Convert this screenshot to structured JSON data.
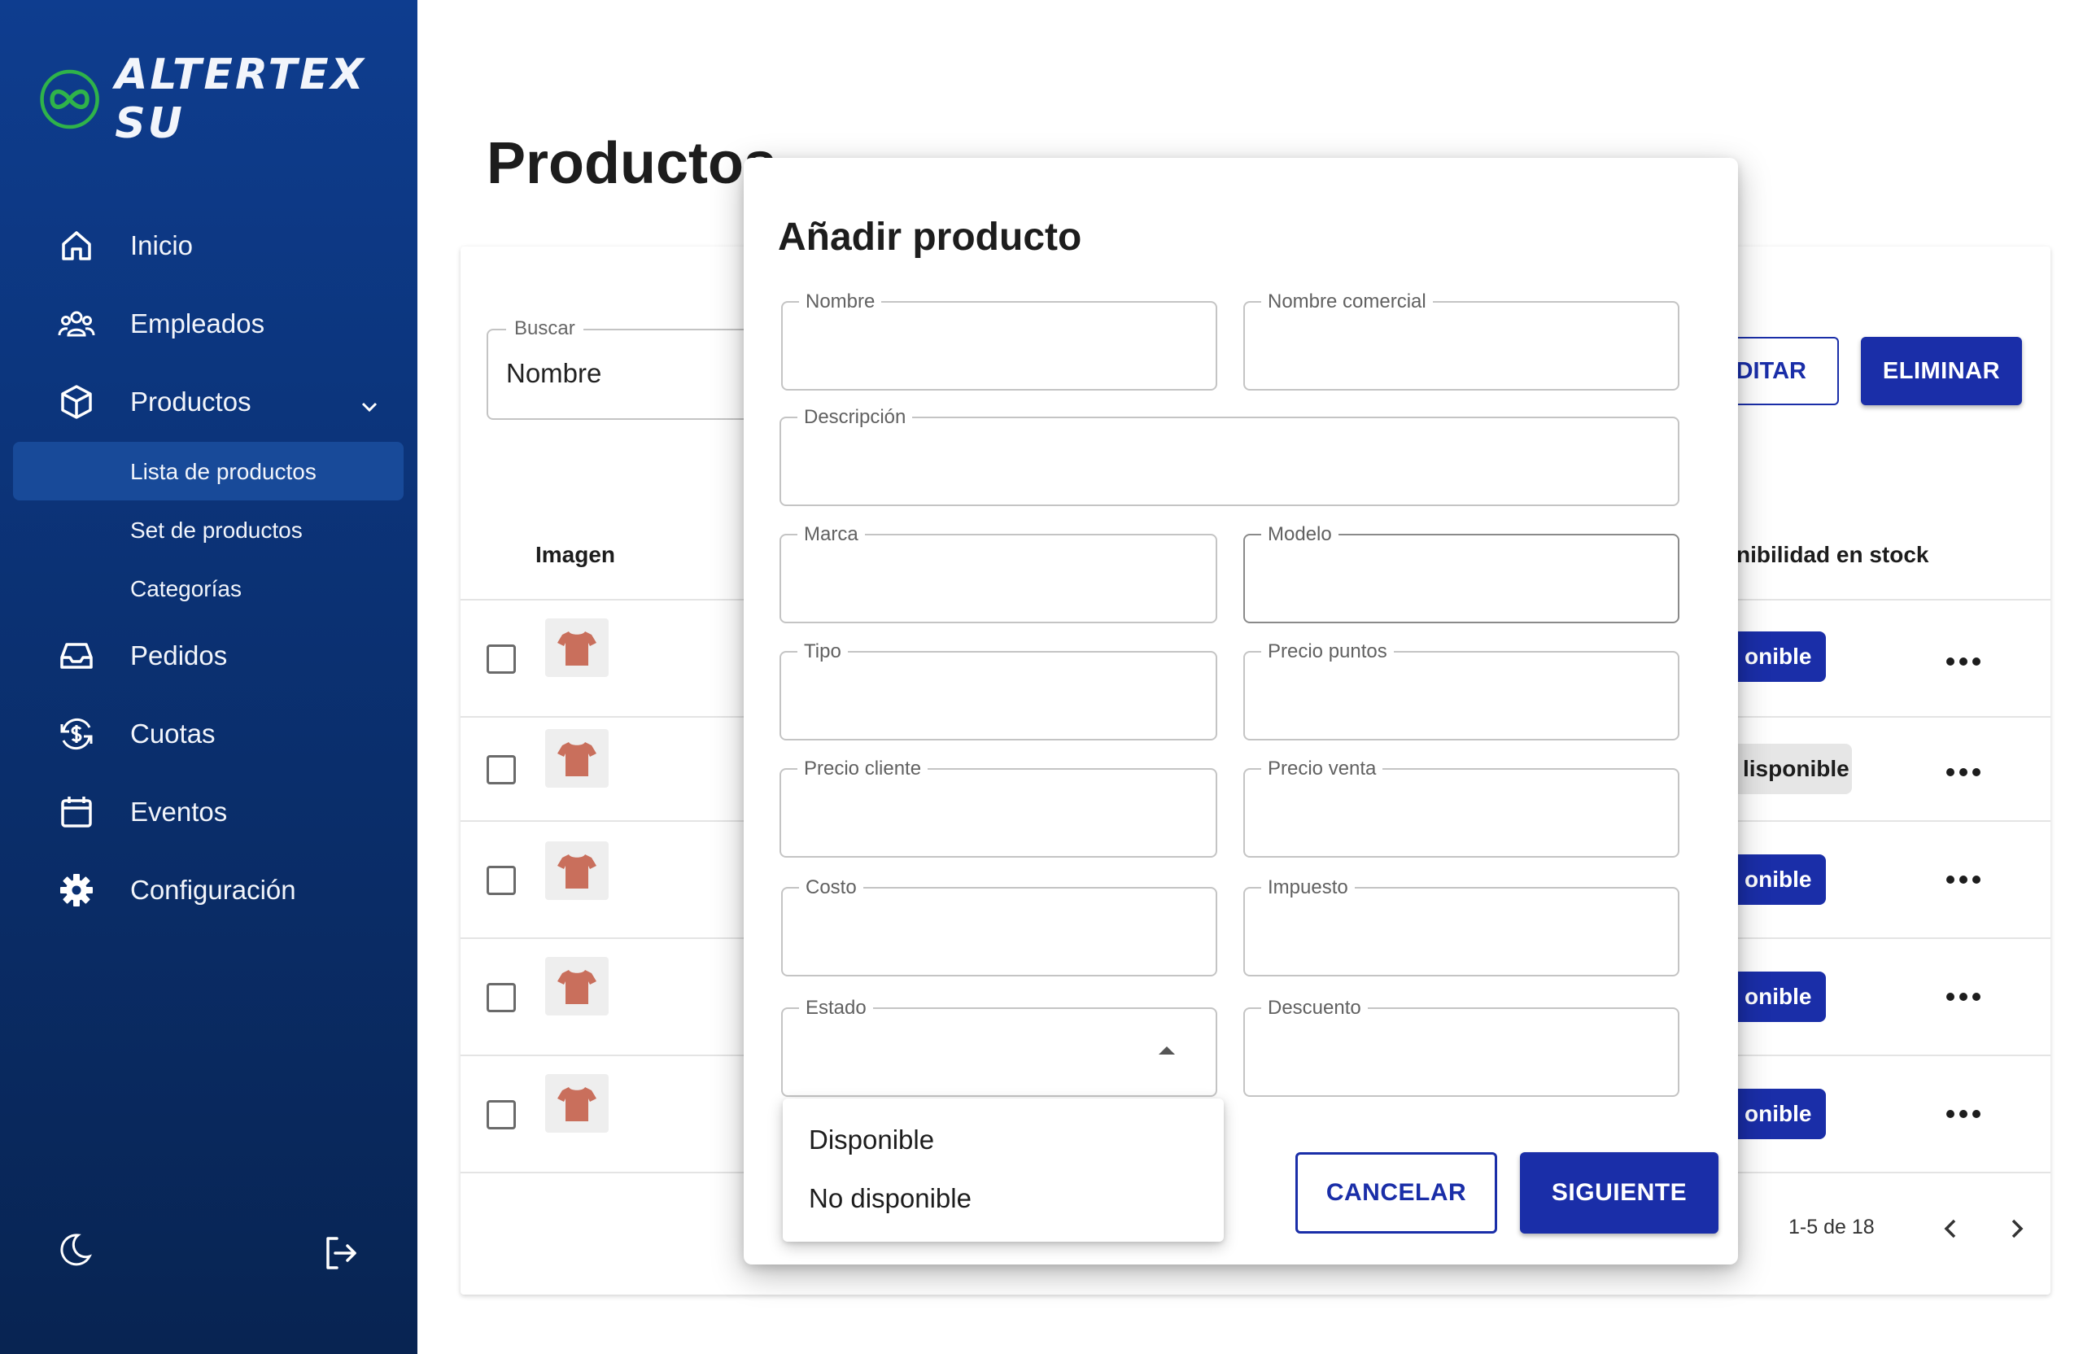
{
  "brand": {
    "name": "ALTERTEX SU"
  },
  "sidebar": {
    "items": [
      {
        "label": "Inicio",
        "icon": "home-icon"
      },
      {
        "label": "Empleados",
        "icon": "people-icon"
      },
      {
        "label": "Productos",
        "icon": "cube-icon"
      },
      {
        "label": "Pedidos",
        "icon": "inbox-icon"
      },
      {
        "label": "Cuotas",
        "icon": "dollar-cycle-icon"
      },
      {
        "label": "Eventos",
        "icon": "calendar-icon"
      },
      {
        "label": "Configuración",
        "icon": "gear-icon"
      }
    ],
    "subitems": [
      {
        "label": "Lista de productos",
        "active": true
      },
      {
        "label": "Set de productos",
        "active": false
      },
      {
        "label": "Categorías",
        "active": false
      }
    ]
  },
  "page": {
    "title": "Productos"
  },
  "search": {
    "label": "Buscar",
    "value": "Nombre"
  },
  "toolbar": {
    "edit_label": "DITAR",
    "delete_label": "ELIMINAR"
  },
  "table": {
    "headers": {
      "image": "Imagen",
      "stock": "nibilidad en stock"
    },
    "rows": [
      {
        "status": "onible",
        "status_kind": "blue"
      },
      {
        "status": "lisponible",
        "status_kind": "grey"
      },
      {
        "status": "onible",
        "status_kind": "blue"
      },
      {
        "status": "onible",
        "status_kind": "blue"
      },
      {
        "status": "onible",
        "status_kind": "blue"
      }
    ]
  },
  "pagination": {
    "text": "1-5 de 18"
  },
  "modal": {
    "title": "Añadir producto",
    "fields": {
      "nombre": "Nombre",
      "nombre_comercial": "Nombre comercial",
      "descripcion": "Descripción",
      "marca": "Marca",
      "modelo": "Modelo",
      "tipo": "Tipo",
      "precio_puntos": "Precio puntos",
      "precio_cliente": "Precio cliente",
      "precio_venta": "Precio venta",
      "costo": "Costo",
      "impuesto": "Impuesto",
      "estado": "Estado",
      "descuento": "Descuento"
    },
    "estado_options": [
      "Disponible",
      "No disponible"
    ],
    "cancel_label": "CANCELAR",
    "next_label": "SIGUIENTE"
  },
  "colors": {
    "sidebar_top": "#0e3d8f",
    "sidebar_bottom": "#082452",
    "accent": "#1a2ea8",
    "logo_green": "#2fb34a"
  }
}
